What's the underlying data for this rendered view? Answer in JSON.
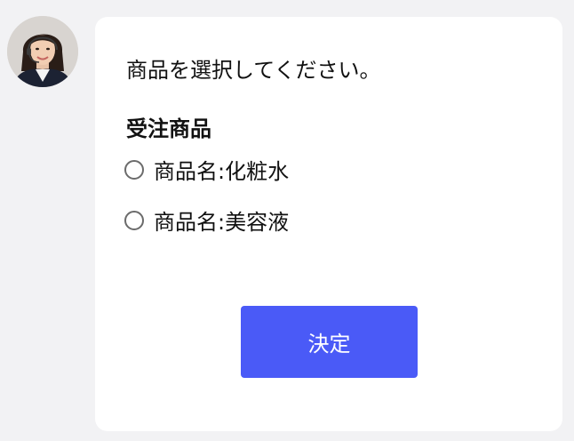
{
  "message": {
    "prompt": "商品を選択してください。",
    "group_title": "受注商品",
    "options": [
      {
        "label": "商品名:化粧水",
        "selected": false
      },
      {
        "label": "商品名:美容液",
        "selected": false
      }
    ],
    "submit_label": "決定"
  },
  "colors": {
    "page_bg": "#f2f2f4",
    "card_bg": "#ffffff",
    "button_bg": "#4a5af7",
    "button_text": "#ffffff",
    "radio_border": "#6b6b6b"
  }
}
